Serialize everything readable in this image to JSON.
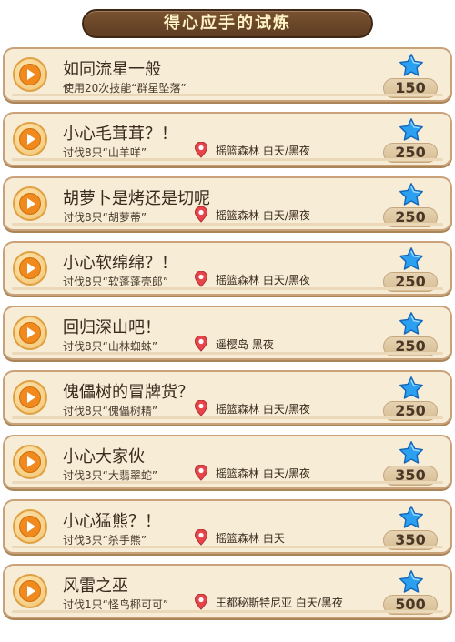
{
  "header": {
    "title": "得心应手的试炼"
  },
  "quests": [
    {
      "name": "如同流星一般",
      "desc": "使用20次技能“群星坠落”",
      "location": "",
      "points": "150"
    },
    {
      "name": "小心毛茸茸？！",
      "desc": "讨伐8只“山羊咩”",
      "location": "摇篮森林 白天/黑夜",
      "points": "250"
    },
    {
      "name": "胡萝卜是烤还是切呢",
      "desc": "讨伐8只“胡萝蒂”",
      "location": "摇篮森林 白天/黑夜",
      "points": "250"
    },
    {
      "name": "小心软绵绵？！",
      "desc": "讨伐8只“软蓬蓬壳郎”",
      "location": "摇篮森林 白天/黑夜",
      "points": "250"
    },
    {
      "name": "回归深山吧！",
      "desc": "讨伐8只“山林蜘蛛”",
      "location": "遥樱岛 黑夜",
      "points": "250"
    },
    {
      "name": "傀儡树的冒牌货？",
      "desc": "讨伐8只“傀儡树精”",
      "location": "摇篮森林 白天/黑夜",
      "points": "250"
    },
    {
      "name": "小心大家伙",
      "desc": "讨伐3只“大翡翠蛇”",
      "location": "摇篮森林 白天/黑夜",
      "points": "350"
    },
    {
      "name": "小心猛熊？！",
      "desc": "讨伐3只“杀手熊”",
      "location": "摇篮森林 白天",
      "points": "350"
    },
    {
      "name": "风雷之巫",
      "desc": "讨伐1只“怪鸟椰可可”",
      "location": "王都秘斯特尼亚 白天/黑夜",
      "points": "500"
    }
  ],
  "icons": {
    "play": "play-icon",
    "location": "location-pin-icon",
    "reward": "star-icon"
  },
  "colors": {
    "star": "#2b9ff0",
    "play": "#f08a1e",
    "pin": "#e8454a",
    "title_bg": "#6b4628"
  }
}
